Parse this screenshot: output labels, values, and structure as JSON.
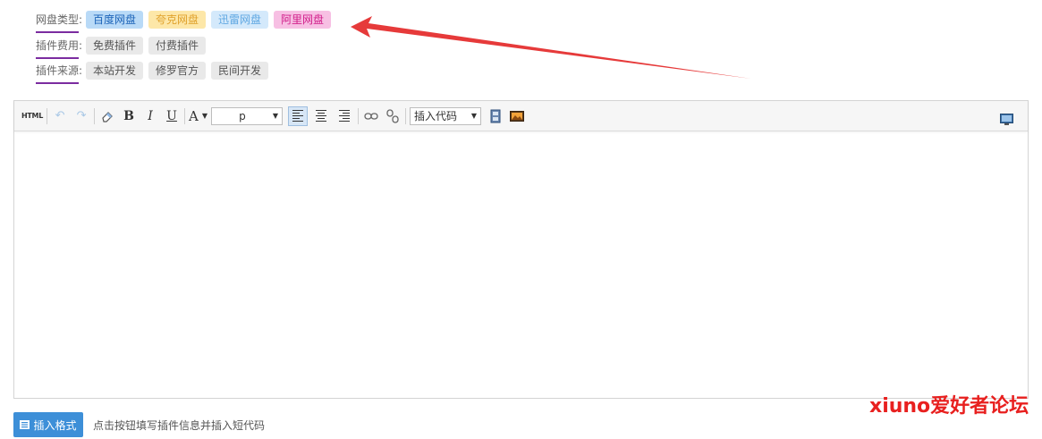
{
  "filters": {
    "pan_type": {
      "label": "网盘类型:",
      "options": [
        "百度网盘",
        "夸克网盘",
        "迅雷网盘",
        "阿里网盘"
      ]
    },
    "plugin_fee": {
      "label": "插件费用:",
      "options": [
        "免费插件",
        "付费插件"
      ]
    },
    "plugin_source": {
      "label": "插件来源:",
      "options": [
        "本站开发",
        "修罗官方",
        "民间开发"
      ]
    }
  },
  "toolbar": {
    "html_label": "HTML",
    "bold_label": "B",
    "italic_label": "I",
    "underline_label": "U",
    "font_color_label": "A",
    "paragraph_value": "p",
    "insert_code_value": "插入代码"
  },
  "footer": {
    "insert_format_label": "插入格式",
    "hint_text": "点击按钮填写插件信息并插入短代码"
  },
  "watermark": "xiuno爱好者论坛",
  "colors": {
    "accent": "#3d8fd8",
    "arrow": "#e63a3a",
    "label_underline": "#7b2ca0"
  }
}
